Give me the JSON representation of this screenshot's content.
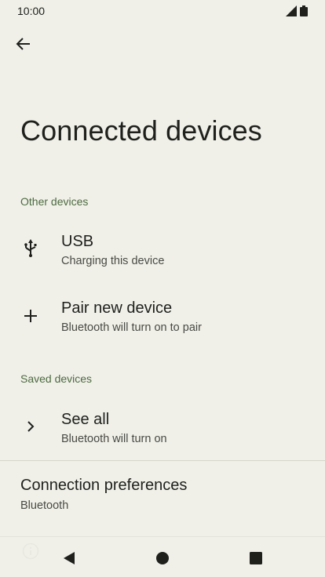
{
  "status_bar": {
    "time": "10:00",
    "icons": [
      "signal-icon",
      "battery-icon"
    ]
  },
  "header": {
    "back_icon": "arrow-back-icon",
    "title": "Connected devices"
  },
  "sections": {
    "other": {
      "header": "Other devices",
      "items": [
        {
          "icon": "usb-icon",
          "title": "USB",
          "subtitle": "Charging this device"
        },
        {
          "icon": "plus-icon",
          "title": "Pair new device",
          "subtitle": "Bluetooth will turn on to pair"
        }
      ]
    },
    "saved": {
      "header": "Saved devices",
      "items": [
        {
          "icon": "chevron-right-icon",
          "title": "See all",
          "subtitle": "Bluetooth will turn on"
        }
      ]
    }
  },
  "preferences": {
    "title": "Connection preferences",
    "subtitle": "Bluetooth"
  },
  "nav_bar": {
    "buttons": [
      "back-triangle-icon",
      "home-circle-icon",
      "recents-square-icon"
    ]
  },
  "colors": {
    "background": "#f0f0e9",
    "accent": "#4c6a3f",
    "text": "#1f1f1c",
    "secondary_text": "#4a4a45"
  }
}
